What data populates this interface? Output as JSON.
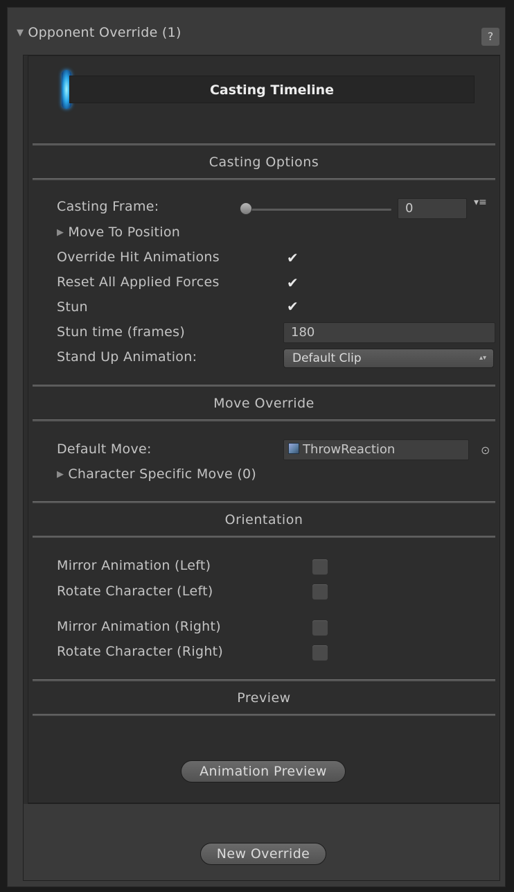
{
  "panel": {
    "title": "Opponent Override (1)",
    "help_label": "?"
  },
  "timeline": {
    "title": "Casting Timeline"
  },
  "sections": {
    "casting_options": "Casting Options",
    "move_override": "Move Override",
    "orientation": "Orientation",
    "preview": "Preview"
  },
  "casting": {
    "frame_label": "Casting Frame:",
    "frame_value": "0",
    "move_to_position_label": "Move To Position",
    "override_hit_label": "Override Hit Animations",
    "override_hit_checked": true,
    "reset_forces_label": "Reset All Applied Forces",
    "reset_forces_checked": true,
    "stun_label": "Stun",
    "stun_checked": true,
    "stun_time_label": "Stun time (frames)",
    "stun_time_value": "180",
    "stand_up_label": "Stand Up Animation:",
    "stand_up_value": "Default Clip"
  },
  "move_override": {
    "default_move_label": "Default Move:",
    "default_move_value": "ThrowReaction",
    "character_specific_label": "Character Specific Move (0)"
  },
  "orientation": {
    "mirror_left_label": "Mirror Animation (Left)",
    "mirror_left_checked": false,
    "rotate_left_label": "Rotate Character (Left)",
    "rotate_left_checked": false,
    "mirror_right_label": "Mirror Animation (Right)",
    "mirror_right_checked": false,
    "rotate_right_label": "Rotate Character (Right)",
    "rotate_right_checked": false
  },
  "buttons": {
    "animation_preview": "Animation Preview",
    "new_override": "New Override"
  },
  "icons": {
    "foldout_open": "▼",
    "foldout_closed": "▶",
    "check": "✔",
    "menu": "▾≡",
    "picker": "⊙",
    "dropdown": "▴▾"
  }
}
